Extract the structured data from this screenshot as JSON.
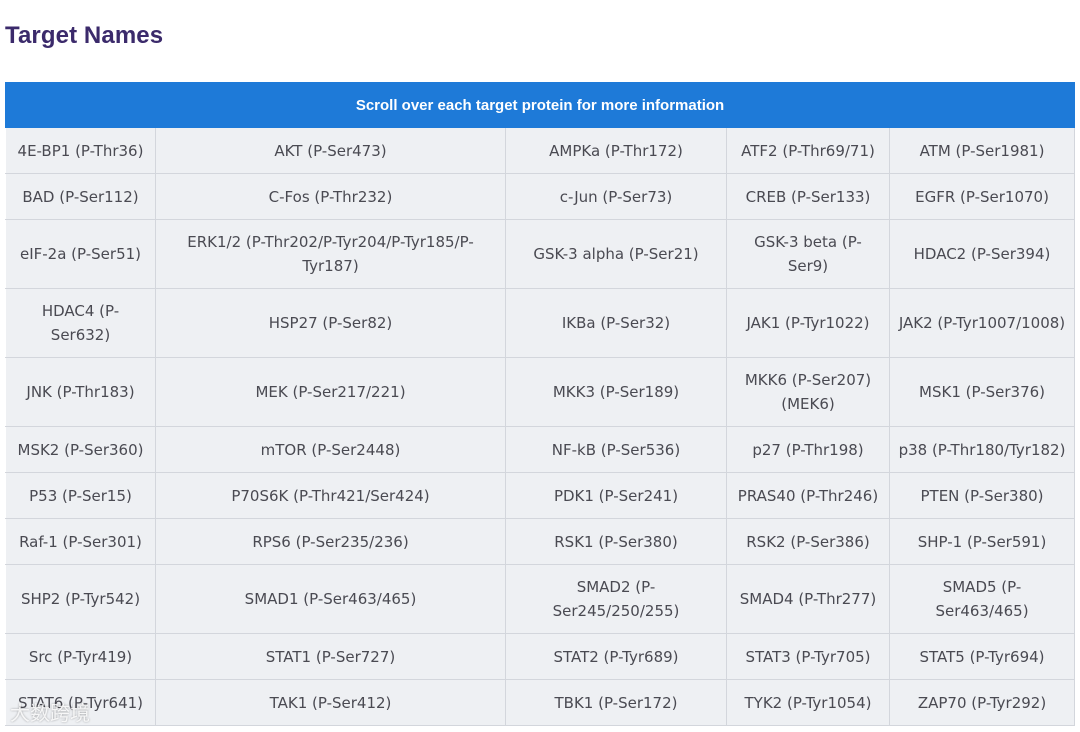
{
  "page": {
    "heading": "Target Names"
  },
  "table": {
    "header": "Scroll over each target protein for more information",
    "rows": [
      [
        "4E-BP1 (P-Thr36)",
        "AKT (P-Ser473)",
        "AMPKa (P-Thr172)",
        "ATF2 (P-Thr69/71)",
        "ATM (P-Ser1981)"
      ],
      [
        "BAD (P-Ser112)",
        "C-Fos (P-Thr232)",
        "c-Jun (P-Ser73)",
        "CREB (P-Ser133)",
        "EGFR (P-Ser1070)"
      ],
      [
        "eIF-2a (P-Ser51)",
        "ERK1/2 (P-Thr202/P-Tyr204/P-Tyr185/P-Tyr187)",
        "GSK-3 alpha (P-Ser21)",
        "GSK-3 beta (P-Ser9)",
        "HDAC2 (P-Ser394)"
      ],
      [
        "HDAC4 (P-Ser632)",
        "HSP27 (P-Ser82)",
        "IKBa (P-Ser32)",
        "JAK1 (P-Tyr1022)",
        "JAK2 (P-Tyr1007/1008)"
      ],
      [
        "JNK (P-Thr183)",
        "MEK (P-Ser217/221)",
        "MKK3 (P-Ser189)",
        "MKK6 (P-Ser207) (MEK6)",
        "MSK1 (P-Ser376)"
      ],
      [
        "MSK2 (P-Ser360)",
        "mTOR (P-Ser2448)",
        "NF-kB (P-Ser536)",
        "p27 (P-Thr198)",
        "p38 (P-Thr180/Tyr182)"
      ],
      [
        "P53 (P-Ser15)",
        "P70S6K (P-Thr421/Ser424)",
        "PDK1 (P-Ser241)",
        "PRAS40 (P-Thr246)",
        "PTEN (P-Ser380)"
      ],
      [
        "Raf-1 (P-Ser301)",
        "RPS6 (P-Ser235/236)",
        "RSK1 (P-Ser380)",
        "RSK2 (P-Ser386)",
        "SHP-1 (P-Ser591)"
      ],
      [
        "SHP2 (P-Tyr542)",
        "SMAD1 (P-Ser463/465)",
        "SMAD2 (P-Ser245/250/255)",
        "SMAD4 (P-Thr277)",
        "SMAD5 (P-Ser463/465)"
      ],
      [
        "Src (P-Tyr419)",
        "STAT1 (P-Ser727)",
        "STAT2 (P-Tyr689)",
        "STAT3 (P-Tyr705)",
        "STAT5 (P-Tyr694)"
      ],
      [
        "STAT6 (P-Tyr641)",
        "TAK1 (P-Ser412)",
        "TBK1 (P-Ser172)",
        "TYK2 (P-Tyr1054)",
        "ZAP70 (P-Tyr292)"
      ]
    ]
  },
  "watermark": {
    "text": "大数跨境"
  },
  "colors": {
    "heading": "#3b2a6b",
    "header_bg": "#1e7ad8",
    "cell_bg": "#eef0f3",
    "cell_text": "#4a4a52"
  }
}
